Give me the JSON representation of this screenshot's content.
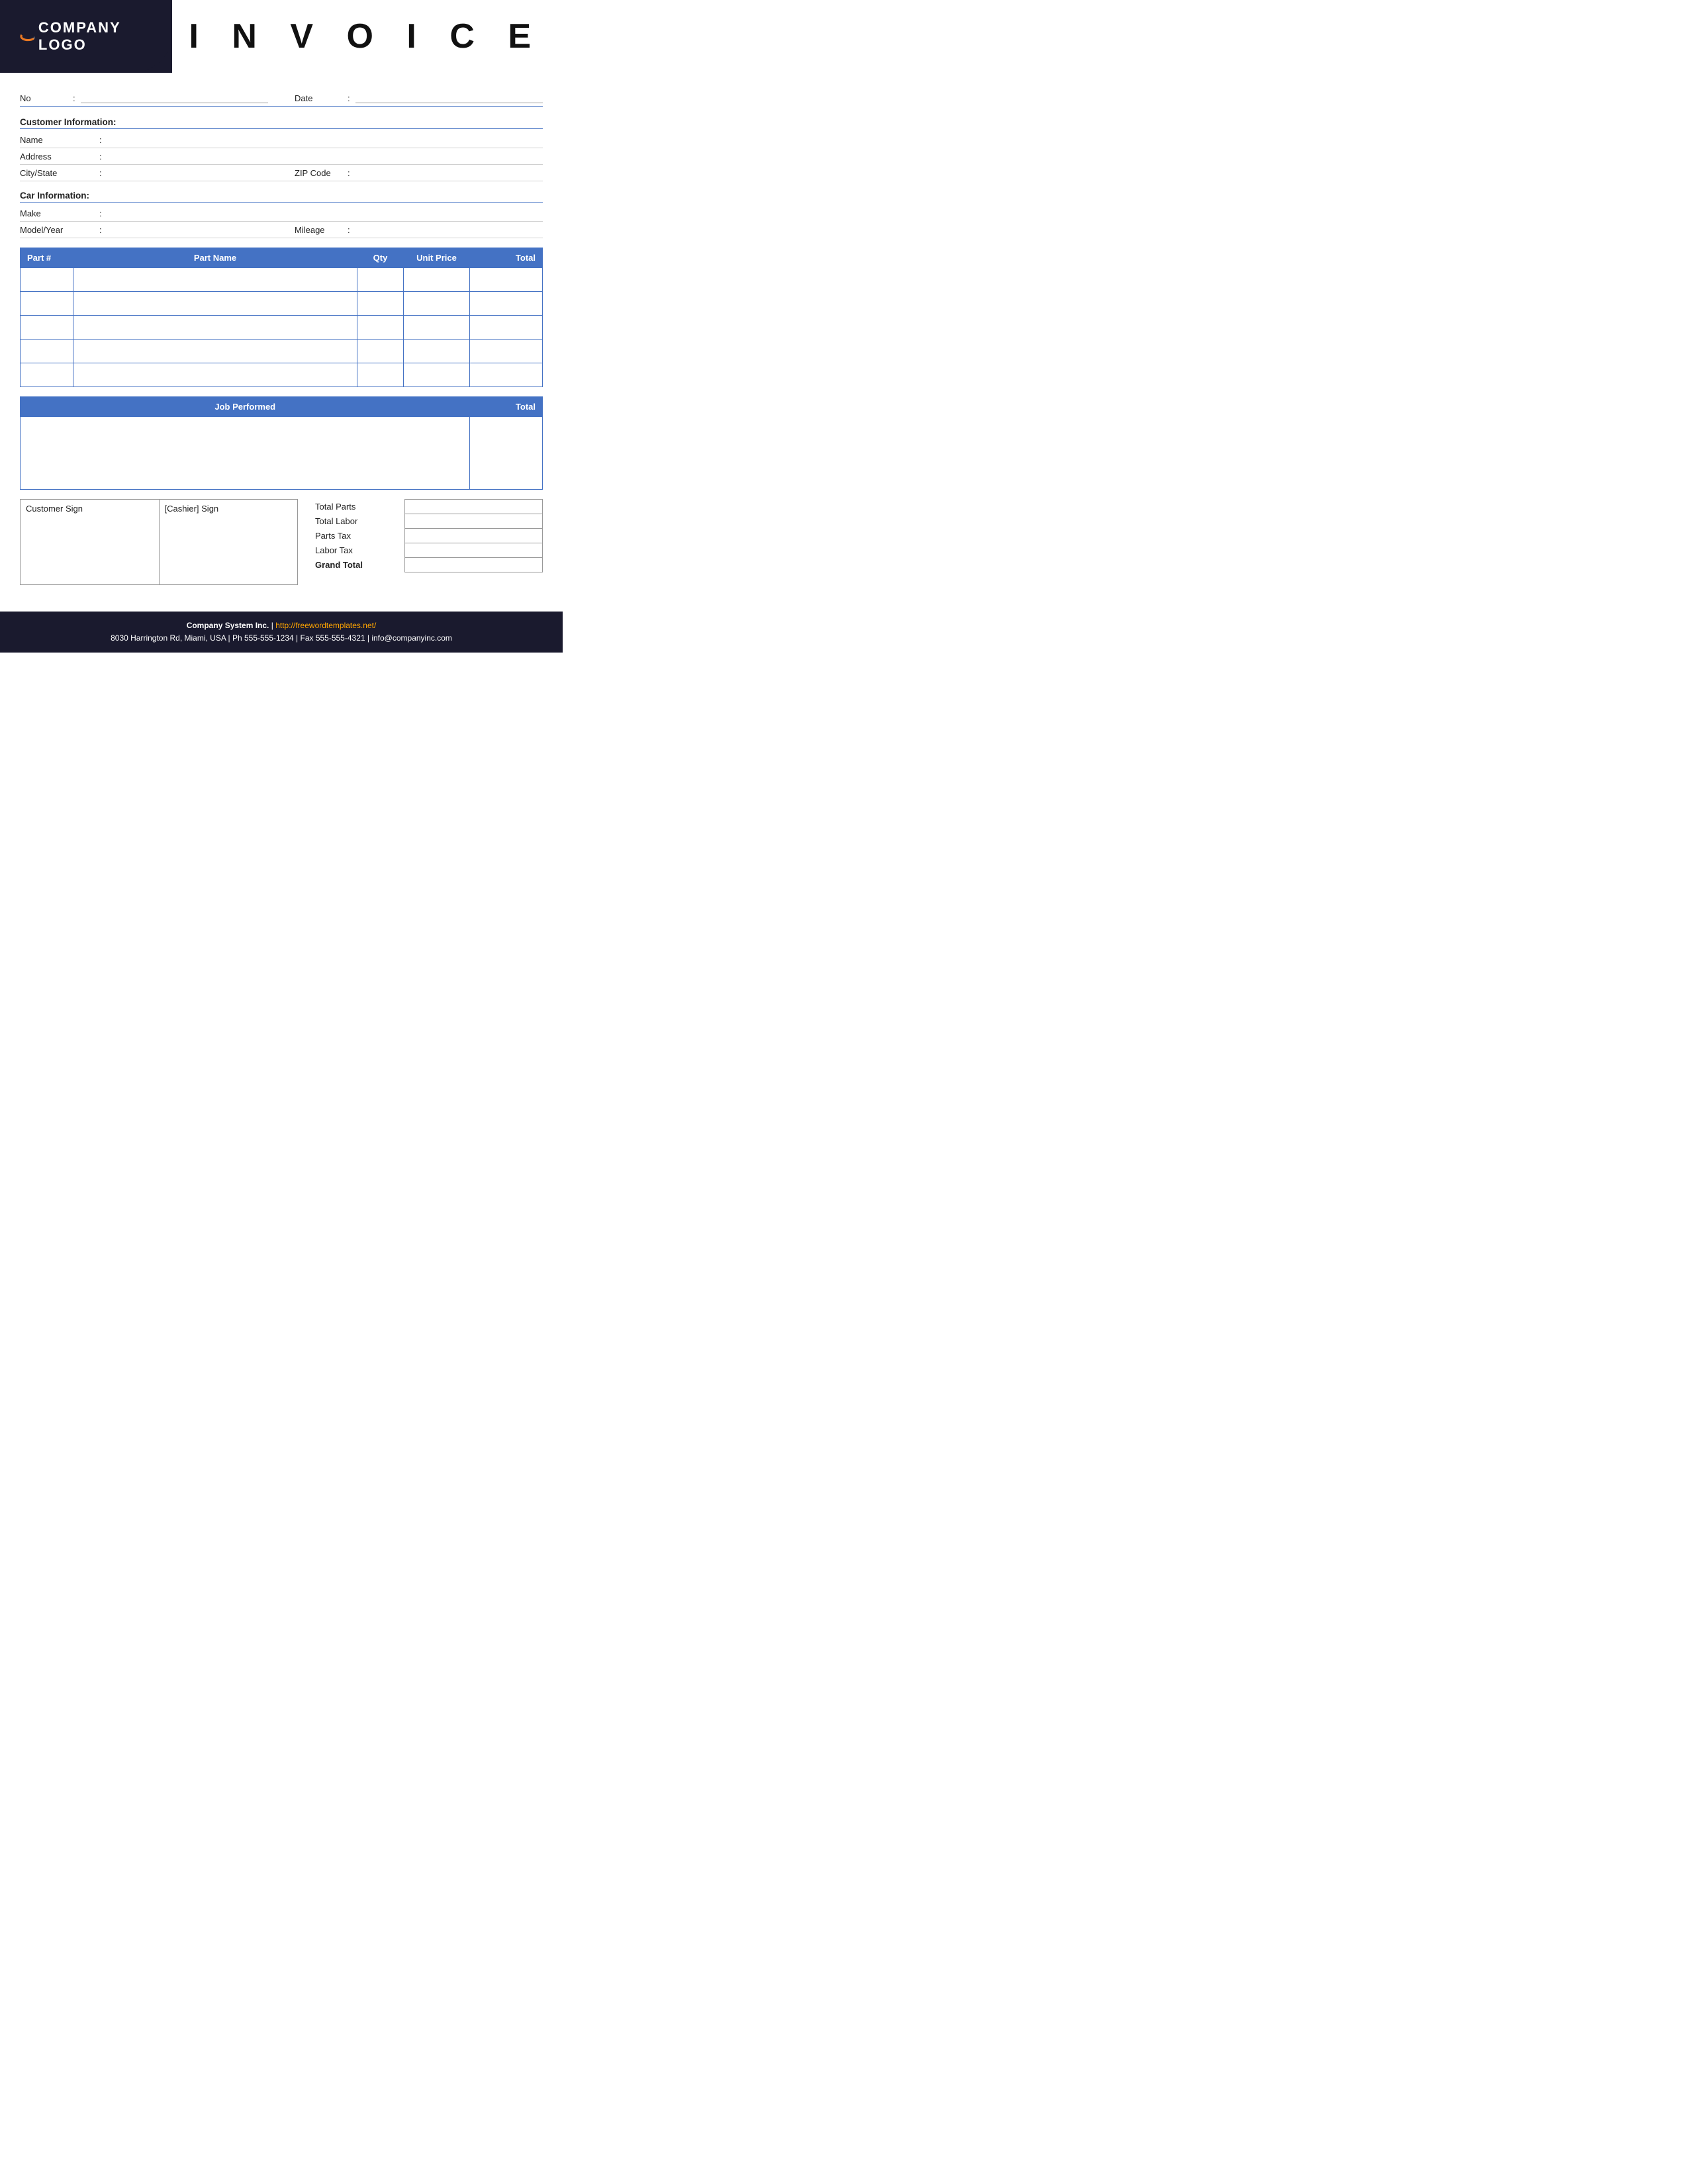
{
  "header": {
    "logo_text": "COMPANY LOGO",
    "invoice_title": "I N V O I C E"
  },
  "top_fields": {
    "no_label": "No",
    "date_label": "Date",
    "colon": ":"
  },
  "customer_info": {
    "section_title": "Customer Information:",
    "name_label": "Name",
    "address_label": "Address",
    "city_state_label": "City/State",
    "zip_label": "ZIP Code",
    "colon": ":"
  },
  "car_info": {
    "section_title": "Car Information:",
    "make_label": "Make",
    "model_year_label": "Model/Year",
    "mileage_label": "Mileage",
    "colon": ":"
  },
  "parts_table": {
    "headers": [
      "Part #",
      "Part Name",
      "Qty",
      "Unit Price",
      "Total"
    ],
    "rows": [
      {
        "part_num": "",
        "part_name": "",
        "qty": "",
        "unit_price": "",
        "total": ""
      },
      {
        "part_num": "",
        "part_name": "",
        "qty": "",
        "unit_price": "",
        "total": ""
      },
      {
        "part_num": "",
        "part_name": "",
        "qty": "",
        "unit_price": "",
        "total": ""
      },
      {
        "part_num": "",
        "part_name": "",
        "qty": "",
        "unit_price": "",
        "total": ""
      },
      {
        "part_num": "",
        "part_name": "",
        "qty": "",
        "unit_price": "",
        "total": ""
      }
    ]
  },
  "job_table": {
    "headers": [
      "Job Performed",
      "Total"
    ],
    "rows": [
      {
        "job": "",
        "total": ""
      }
    ]
  },
  "signatures": {
    "customer_sign": "Customer Sign",
    "cashier_sign": "[Cashier] Sign"
  },
  "totals": {
    "total_parts_label": "Total Parts",
    "total_labor_label": "Total Labor",
    "parts_tax_label": "Parts Tax",
    "labor_tax_label": "Labor Tax",
    "grand_total_label": "Grand Total",
    "total_parts_value": "",
    "total_labor_value": "",
    "parts_tax_value": "",
    "labor_tax_value": "",
    "grand_total_value": ""
  },
  "footer": {
    "company_name": "Company System Inc.",
    "separator": "|",
    "website": "http://freewordtemplates.net/",
    "address_line": "8030 Harrington Rd, Miami, USA | Ph 555-555-1234 | Fax 555-555-4321 | info@companyinc.com"
  }
}
